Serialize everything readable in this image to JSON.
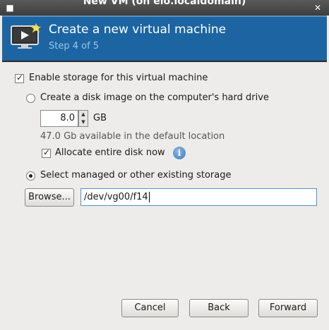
{
  "window": {
    "title": "New VM (on elo.localdomain)",
    "menu_icon": "window-menu-icon",
    "close_icon": "close-icon"
  },
  "header": {
    "icon": "vm-screen-icon",
    "title": "Create a new virtual machine",
    "step": "Step 4 of 5",
    "colors": {
      "background": "#1c65a2",
      "step_text": "#9cc5ea"
    }
  },
  "storage": {
    "enable_label": "Enable storage for this virtual machine",
    "enable_checked": true,
    "create_disk": {
      "label": "Create a disk image on the computer's hard drive",
      "selected": false,
      "size_value": "8.0",
      "size_unit": "GB",
      "available_text": "47.0 Gb available in the default location",
      "allocate_label": "Allocate entire disk now",
      "allocate_checked": true,
      "info_icon": "info-icon"
    },
    "existing": {
      "label": "Select managed or other existing storage",
      "selected": true,
      "browse_label": "Browse...",
      "path_value": "/dev/vg00/f14"
    }
  },
  "footer": {
    "cancel_label": "Cancel",
    "back_label": "Back",
    "forward_label": "Forward"
  }
}
